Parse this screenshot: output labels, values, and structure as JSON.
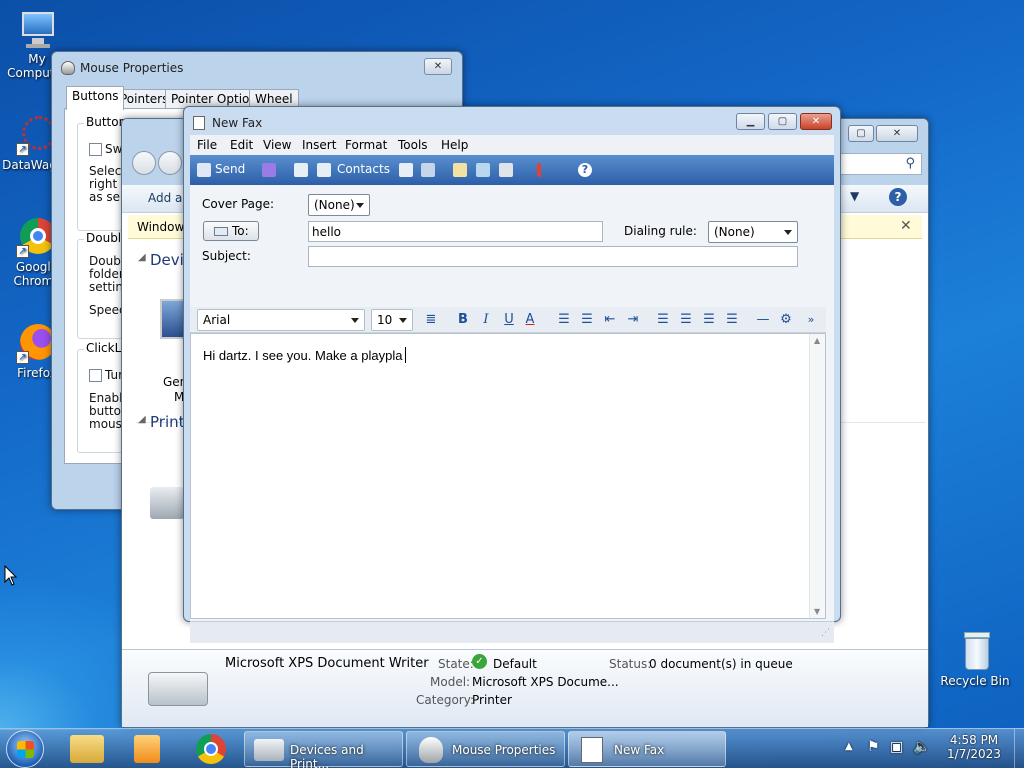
{
  "desktop": {
    "icons": [
      {
        "label": "My Computer"
      },
      {
        "label": "DataWagon"
      },
      {
        "label": "Google Chrome"
      },
      {
        "label": "Firefox"
      },
      {
        "label": "Recycle Bin"
      }
    ]
  },
  "mouse_properties": {
    "title": "Mouse Properties",
    "tabs": [
      "Buttons",
      "Pointers",
      "Pointer Options",
      "Wheel"
    ],
    "fragments": {
      "button_group": "Button",
      "switch": "Swi",
      "select1": "Select",
      "select2": "right th",
      "select3": "as sele",
      "double_group": "Double",
      "double1": "Double",
      "double2": "folder o",
      "double3": "setting.",
      "speed": "Speed:",
      "clicklock_group": "ClickLo",
      "turn": "Turn",
      "enable1": "Enable",
      "enable2": "button.",
      "enable3": "mouse"
    }
  },
  "devices_window": {
    "add_label": "Add a",
    "info_bar": "Window",
    "devices_header": "Devic",
    "printers_header": "Printe",
    "generic_device": "Gen",
    "generic_device_2": "M",
    "details": {
      "name": "Microsoft XPS Document Writer",
      "state_label": "State:",
      "state_value": "Default",
      "status_label": "Status:",
      "status_value": "0 document(s) in queue",
      "model_label": "Model:",
      "model_value": "Microsoft XPS Docume...",
      "category_label": "Category:",
      "category_value": "Printer"
    }
  },
  "fax": {
    "title": "New Fax",
    "menu": [
      "File",
      "Edit",
      "View",
      "Insert",
      "Format",
      "Tools",
      "Help"
    ],
    "toolbar": {
      "send": "Send",
      "contacts": "Contacts"
    },
    "cover_page_label": "Cover Page:",
    "cover_page_value": "(None)",
    "to_button": "To:",
    "to_value": "hello",
    "dialing_rule_label": "Dialing rule:",
    "dialing_rule_value": "(None)",
    "subject_label": "Subject:",
    "subject_value": "",
    "font_name": "Arial",
    "font_size": "10",
    "body_text": "Hi dartz. I see you. Make a playpla"
  },
  "taskbar": {
    "buttons": [
      "Devices and Print...",
      "Mouse Properties",
      "New Fax"
    ],
    "time": "4:58 PM",
    "date": "1/7/2023"
  },
  "colors": {
    "accent": "#2c5fa8",
    "default_badge": "#3aa63a"
  }
}
